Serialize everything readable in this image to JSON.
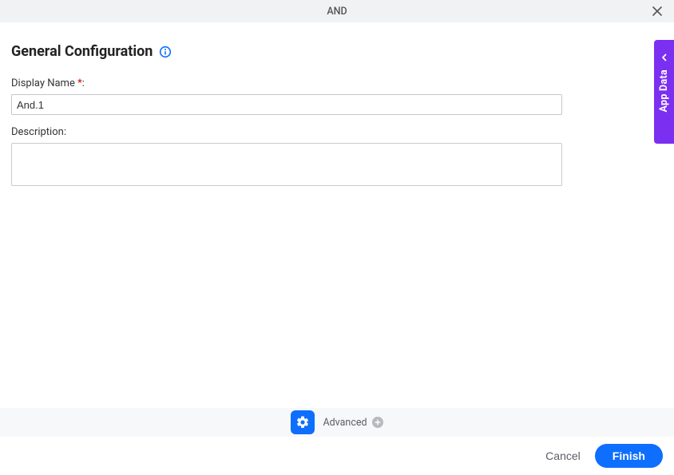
{
  "header": {
    "title": "AND"
  },
  "section": {
    "heading": "General Configuration"
  },
  "form": {
    "display_name_label": "Display Name",
    "display_name_required": "*",
    "display_name_colon": ":",
    "display_name_value": "And.1",
    "description_label": "Description:",
    "description_value": ""
  },
  "side_tab": {
    "label": "App Data"
  },
  "advanced": {
    "label": "Advanced"
  },
  "footer": {
    "cancel": "Cancel",
    "finish": "Finish"
  }
}
